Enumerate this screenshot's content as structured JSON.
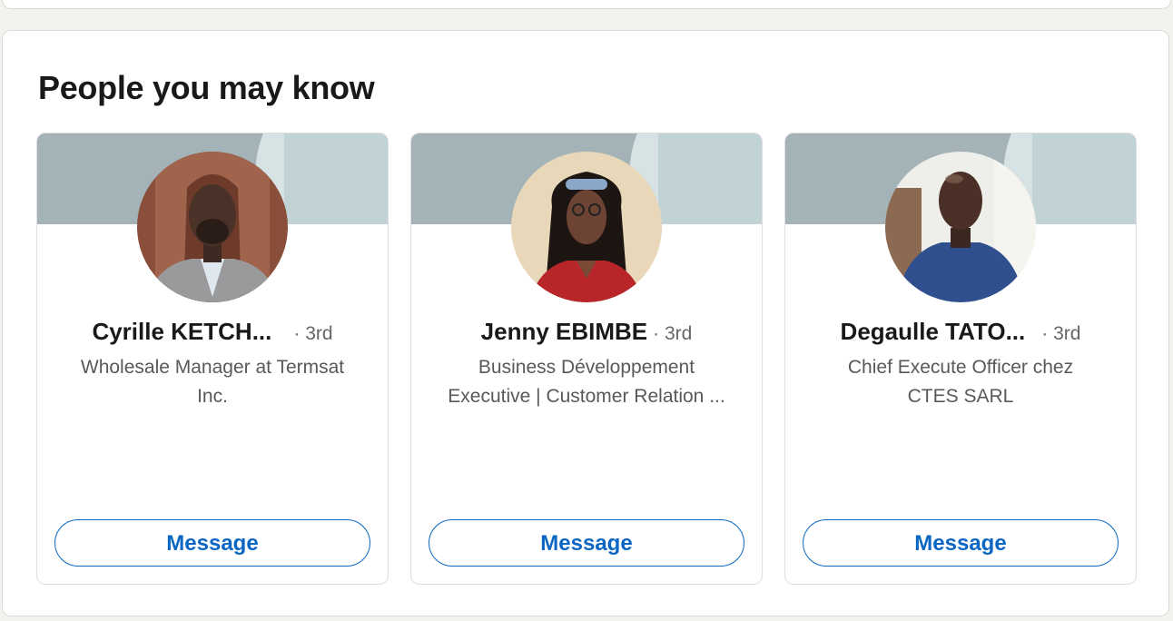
{
  "section": {
    "title": "People you may know"
  },
  "people": [
    {
      "name": "Cyrille KETCH...",
      "degree": "· 3rd",
      "headline_line1": "Wholesale Manager at Termsat",
      "headline_line2": "Inc.",
      "button_label": "Message"
    },
    {
      "name": "Jenny EBIMBE",
      "degree": "· 3rd",
      "headline_line1": "Business Développement",
      "headline_line2": "Executive | Customer Relation ...",
      "button_label": "Message"
    },
    {
      "name": "Degaulle TATO...",
      "degree": "· 3rd",
      "headline_line1": "Chief Execute Officer chez",
      "headline_line2": "CTES SARL",
      "button_label": "Message"
    }
  ],
  "colors": {
    "accent": "#0a66c2",
    "cover_dark": "#a3b3b7",
    "cover_light": "#c2d3d6"
  }
}
